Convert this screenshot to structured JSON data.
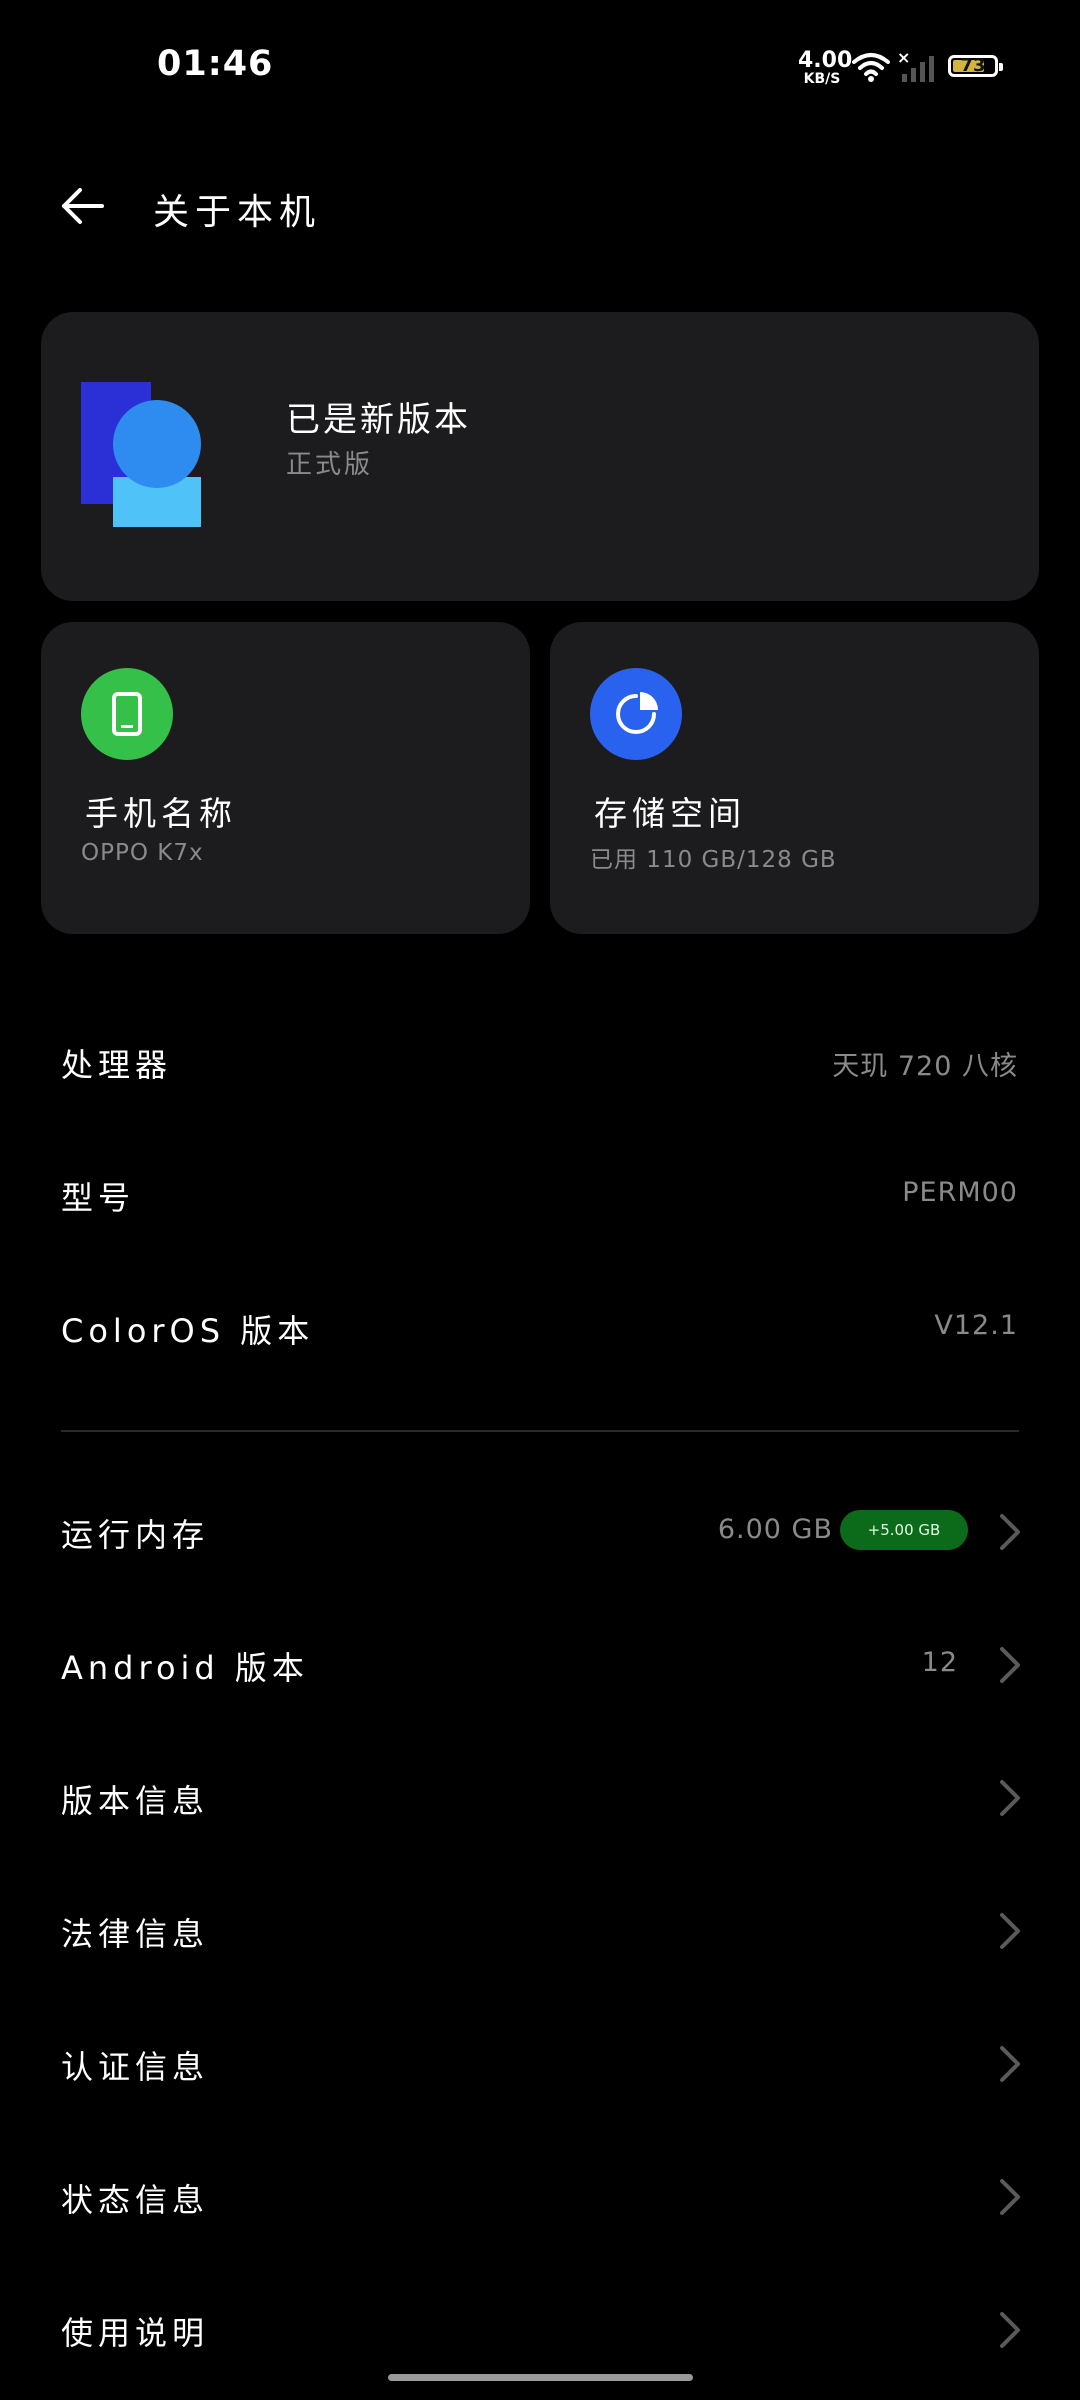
{
  "status": {
    "time": "01:46",
    "net_speed_value": "4.00",
    "net_speed_unit": "KB/S",
    "no_sim_mark": "×",
    "battery": "73",
    "battery_color": "#d2b43f"
  },
  "header": {
    "title": "关于本机",
    "back_icon": "arrow-left-icon"
  },
  "update_card": {
    "title": "已是新版本",
    "subtitle": "正式版",
    "logo_icon": "coloros-logo"
  },
  "phone_card": {
    "title": "手机名称",
    "subtitle": "OPPO K7x",
    "icon": "phone-icon",
    "color": "#35c04a"
  },
  "storage_card": {
    "title": "存储空间",
    "subtitle": "已用 110 GB/128 GB",
    "icon": "pie-chart-icon",
    "color": "#2a62f0"
  },
  "specs": [
    {
      "label": "处理器",
      "value": "天玑 720 八核"
    },
    {
      "label": "型号",
      "value": "PERM00"
    },
    {
      "label": "ColorOS 版本",
      "value": "V12.1"
    }
  ],
  "ram": {
    "label": "运行内存",
    "value": "6.00 GB",
    "badge": "+5.00 GB",
    "badge_color": "#0b6b1a"
  },
  "android": {
    "label": "Android 版本",
    "value": "12"
  },
  "menu": [
    {
      "label": "版本信息"
    },
    {
      "label": "法律信息"
    },
    {
      "label": "认证信息"
    },
    {
      "label": "状态信息"
    },
    {
      "label": "使用说明"
    }
  ]
}
